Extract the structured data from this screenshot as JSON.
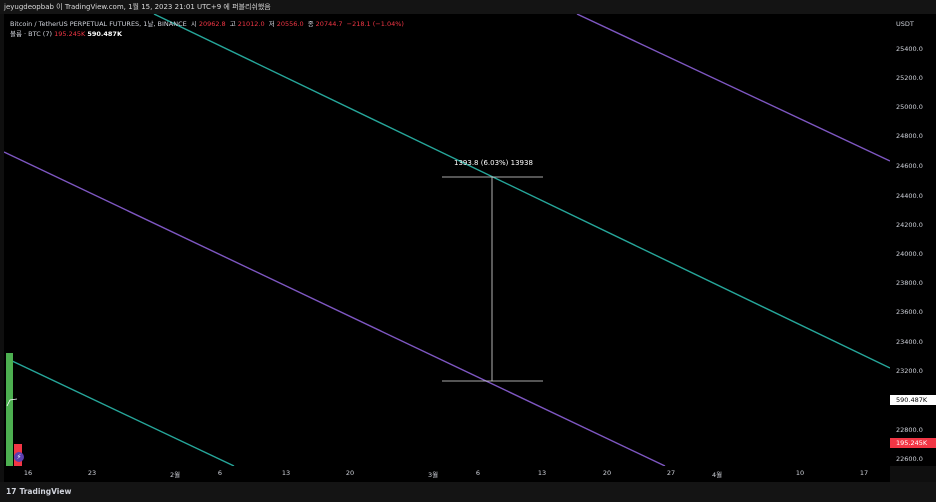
{
  "header": {
    "title": "jeyugdeopbab 이 TradingView.com, 1월 15, 2023 21:01 UTC+9 에 퍼블리쉬했음"
  },
  "legend": {
    "symbol": "Bitcoin / TetherUS PERPETUAL FUTURES, 1날, BINANCE",
    "open_label": "시",
    "open": "20962.8",
    "high_label": "고",
    "high": "21012.0",
    "low_label": "저",
    "low": "20556.0",
    "close_label": "종",
    "close": "20744.7",
    "change": "−218.1 (−1.04%)",
    "volume_label": "볼륨 · BTC (7)",
    "volume_ma": "195.245K",
    "volume": "590.487K"
  },
  "price_axis": {
    "currency": "USDT",
    "ticks": [
      "25400.0",
      "25200.0",
      "25000.0",
      "24800.0",
      "24600.0",
      "24400.0",
      "24200.0",
      "24000.0",
      "23800.0",
      "23600.0",
      "23400.0",
      "23200.0",
      "22800.0",
      "22600.0"
    ],
    "volume_tag": "590.487K",
    "volume_ma_tag": "195.245K"
  },
  "time_axis": {
    "ticks": [
      "16",
      "23",
      "2월",
      "6",
      "13",
      "20",
      "3월",
      "6",
      "13",
      "20",
      "27",
      "4월",
      "10",
      "17"
    ]
  },
  "measure": {
    "label": "1393.8 (6.03%) 13938"
  },
  "colors": {
    "channel_teal": "#26a69a",
    "channel_purple": "#7e57c2",
    "volume_up": "#4caf50",
    "volume_down": "#f23645"
  },
  "footer": {
    "brand": "TradingView"
  }
}
